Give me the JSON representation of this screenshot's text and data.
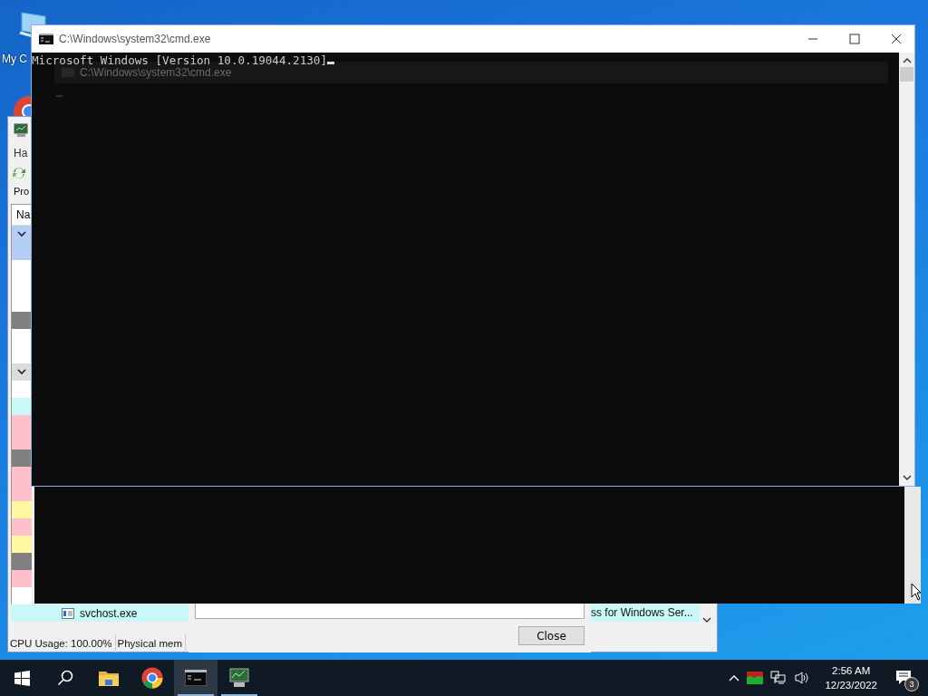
{
  "desktop": {
    "icons": [
      {
        "label": "My C"
      }
    ]
  },
  "process_window": {
    "menu": "Ha",
    "tab": "Pro",
    "column": "Na",
    "rows": [
      {
        "kind": "group",
        "color": "#b4cdf5"
      },
      {
        "kind": "process",
        "color": "#b4cdf5"
      },
      {
        "kind": "blank"
      },
      {
        "kind": "blank"
      },
      {
        "kind": "blank"
      },
      {
        "kind": "process",
        "color": "#808080"
      },
      {
        "kind": "blank"
      },
      {
        "kind": "blank"
      },
      {
        "kind": "group",
        "color": "#dcdcdc"
      },
      {
        "kind": "blank"
      },
      {
        "kind": "process",
        "color": "#c8f8f8"
      },
      {
        "kind": "process",
        "color": "#ffc0cb"
      },
      {
        "kind": "process",
        "color": "#ffc0cb"
      },
      {
        "kind": "process",
        "color": "#808080"
      },
      {
        "kind": "process",
        "color": "#ffc0cb"
      },
      {
        "kind": "process",
        "color": "#ffc0cb"
      },
      {
        "kind": "process",
        "color": "#fff8a0"
      },
      {
        "kind": "process",
        "color": "#ffc0cb"
      },
      {
        "kind": "process",
        "color": "#fff8a0"
      },
      {
        "kind": "process",
        "color": "#808080"
      },
      {
        "kind": "process",
        "color": "#ffc0cb"
      },
      {
        "kind": "blank"
      }
    ],
    "visible_process": {
      "name": "svchost.exe",
      "description": "ss for Windows Ser...",
      "color": "#c8f8f8"
    },
    "status_bar": [
      "CPU Usage: 100.00%",
      "Physical mem"
    ]
  },
  "dialog": {
    "button": "Close"
  },
  "console_window": {
    "title": "C:\\Windows\\system32\\cmd.exe",
    "lines": [
      "Microsoft Windows [Version 10.0.19044.2130]"
    ],
    "ghost_title": "C:\\Windows\\system32\\cmd.exe"
  },
  "taskbar": {
    "apps": [
      {
        "kind": "start",
        "running": false,
        "selected": false
      },
      {
        "kind": "search",
        "running": false,
        "selected": false
      },
      {
        "kind": "folder",
        "running": false,
        "selected": false
      },
      {
        "kind": "browser",
        "running": false,
        "selected": false
      },
      {
        "kind": "terminal",
        "running": true,
        "selected": true
      },
      {
        "kind": "monitor",
        "running": true,
        "selected": false
      }
    ],
    "clock": {
      "time": "2:56 AM",
      "date": "12/23/2022"
    },
    "notifications": "3"
  }
}
